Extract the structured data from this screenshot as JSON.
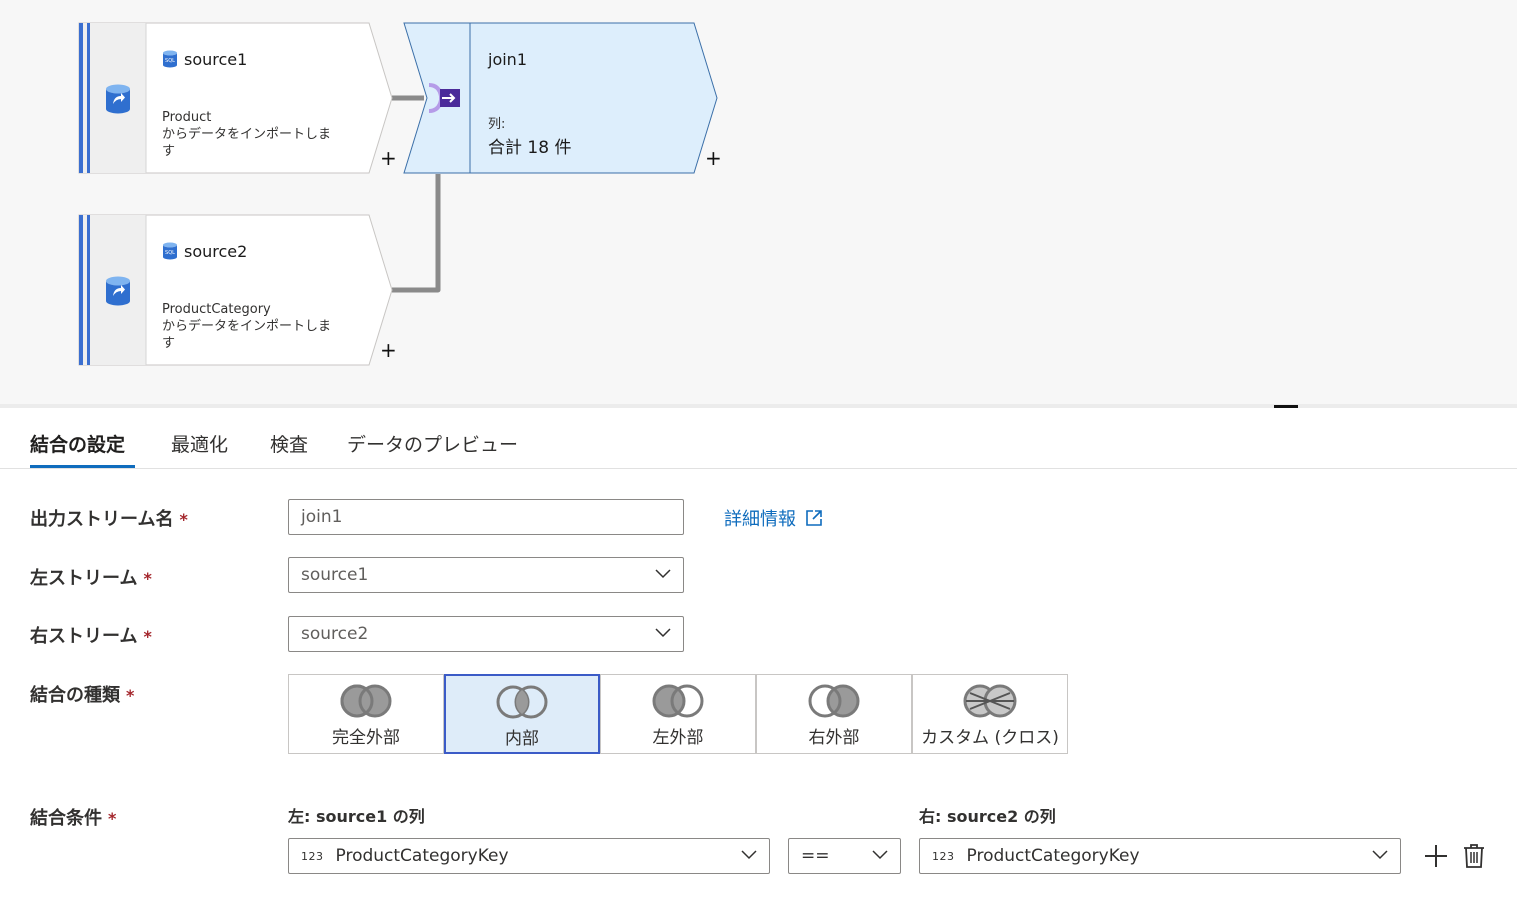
{
  "flow": {
    "source1": {
      "title": "source1",
      "desc_line1": "Product",
      "desc_line2": "からデータをインポートしま",
      "desc_line3": "す",
      "add": "+"
    },
    "source2": {
      "title": "source2",
      "desc_line1": "ProductCategory",
      "desc_line2": "からデータをインポートしま",
      "desc_line3": "す",
      "add": "+"
    },
    "join1": {
      "title": "join1",
      "cols_label": "列:",
      "cols_value": "合計 18 件",
      "add": "+"
    }
  },
  "tabs": [
    {
      "label": "結合の設定",
      "active": true
    },
    {
      "label": "最適化"
    },
    {
      "label": "検査"
    },
    {
      "label": "データのプレビュー"
    }
  ],
  "form": {
    "output_stream_label": "出力ストリーム名",
    "output_stream_value": "join1",
    "more_info_link": "詳細情報",
    "left_stream_label": "左ストリーム",
    "left_stream_value": "source1",
    "right_stream_label": "右ストリーム",
    "right_stream_value": "source2",
    "join_type_label": "結合の種類",
    "join_condition_label": "結合条件",
    "required_mark": "*"
  },
  "join_types": [
    {
      "label": "完全外部",
      "icon": "full-outer-join-icon"
    },
    {
      "label": "内部",
      "icon": "inner-join-icon",
      "selected": true
    },
    {
      "label": "左外部",
      "icon": "left-outer-join-icon"
    },
    {
      "label": "右外部",
      "icon": "right-outer-join-icon"
    },
    {
      "label": "カスタム (クロス)",
      "icon": "cross-join-icon"
    }
  ],
  "condition": {
    "left_header": "左: source1 の列",
    "right_header": "右: source2 の列",
    "type_badge": "123",
    "left_column": "ProductCategoryKey",
    "operator": "==",
    "right_column": "ProductCategoryKey"
  },
  "colors": {
    "accent": "#0f6cbd",
    "selected_border": "#3b5bc7",
    "selected_bg": "#deecf9",
    "join_node_bg": "#ddeefc",
    "required": "#a4262c"
  }
}
